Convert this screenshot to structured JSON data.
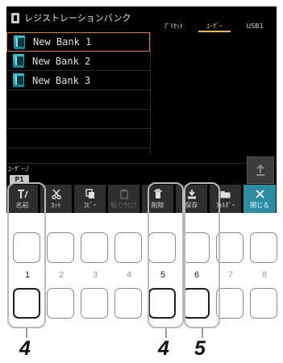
{
  "screen": {
    "title": "レジストレーションバンク",
    "tabs": [
      "ﾌﾟﾘｾｯﾄ",
      "ﾕｰｻﾞｰ",
      "USB1"
    ],
    "active_tab": "ﾕｰｻﾞｰ",
    "banks": [
      "New Bank 1",
      "New Bank 2",
      "New Bank 3"
    ],
    "selected_bank": "New Bank 1",
    "path": "ﾕｰｻﾞｰ:/",
    "page": "P1",
    "function_buttons": [
      {
        "label": "名前",
        "icon": "name-icon"
      },
      {
        "label": "ｶｯﾄ",
        "icon": "scissors-icon"
      },
      {
        "label": "ｺﾋﾟｰ",
        "icon": "copy-icon"
      },
      {
        "label": "貼り付け",
        "icon": "paste-icon",
        "disabled": true
      },
      {
        "label": "削除",
        "icon": "trash-icon"
      },
      {
        "label": "保存",
        "icon": "save-icon"
      },
      {
        "label": "ﾌｫﾙﾀﾞｰ",
        "icon": "folder-icon"
      },
      {
        "label": "閉じる",
        "icon": "close-icon"
      }
    ],
    "colors": {
      "accent": "#e8b84a",
      "selection": "#e07d25",
      "close": "#2a8da2",
      "bank_icon": "#1ea4b2"
    }
  },
  "hardware": {
    "numbers": [
      "1",
      "2",
      "3",
      "4",
      "5",
      "6",
      "7",
      "8"
    ],
    "callouts": [
      "4",
      "4",
      "5"
    ]
  }
}
